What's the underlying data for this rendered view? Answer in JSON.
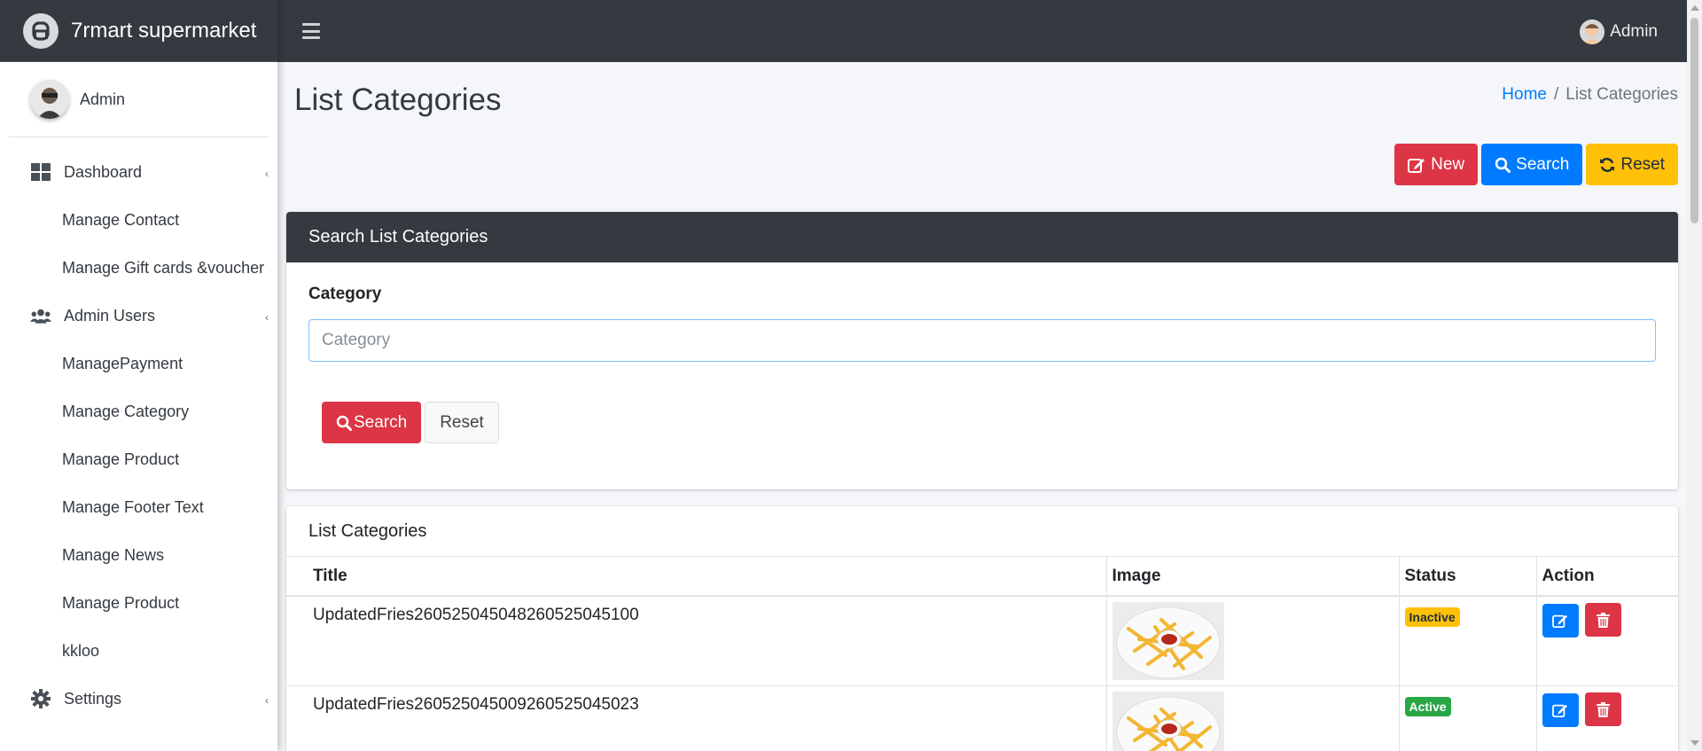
{
  "brand": {
    "name": "7rmart supermarket"
  },
  "sidebar": {
    "user_name": "Admin",
    "items": [
      {
        "label": "Dashboard",
        "icon": "dashboard-icon",
        "sub": false,
        "caret": true
      },
      {
        "label": "Manage Contact",
        "sub": true
      },
      {
        "label": "Manage Gift cards &voucher",
        "sub": true
      },
      {
        "label": "Admin Users",
        "icon": "users-icon",
        "sub": false,
        "caret": true
      },
      {
        "label": "ManagePayment",
        "sub": true
      },
      {
        "label": "Manage Category",
        "sub": true
      },
      {
        "label": "Manage Product",
        "sub": true
      },
      {
        "label": "Manage Footer Text",
        "sub": true
      },
      {
        "label": "Manage News",
        "sub": true
      },
      {
        "label": "Manage Product",
        "sub": true
      },
      {
        "label": "kkloo",
        "sub": true
      },
      {
        "label": "Settings",
        "icon": "gear-icon",
        "sub": false,
        "caret": true
      }
    ]
  },
  "topbar": {
    "user_name": "Admin"
  },
  "page": {
    "title": "List Categories",
    "breadcrumb": {
      "home": "Home",
      "current": "List Categories"
    }
  },
  "actions": {
    "new_label": "New",
    "search_label": "Search",
    "reset_label": "Reset"
  },
  "search_card": {
    "title": "Search List Categories",
    "field_label": "Category",
    "placeholder": "Category",
    "value": "",
    "search_button": "Search",
    "reset_button": "Reset"
  },
  "list_card": {
    "title": "List Categories",
    "columns": [
      "Title",
      "Image",
      "Status",
      "Action"
    ],
    "rows": [
      {
        "title": "UpdatedFries26052504504826052504510​0",
        "status": "Inactive"
      },
      {
        "title": "UpdatedFries2605250450092605250450​23",
        "status": "Active"
      }
    ]
  },
  "colors": {
    "navbar": "#343a40",
    "danger": "#dc3545",
    "primary": "#007bff",
    "warning": "#ffc107",
    "success": "#28a745"
  }
}
